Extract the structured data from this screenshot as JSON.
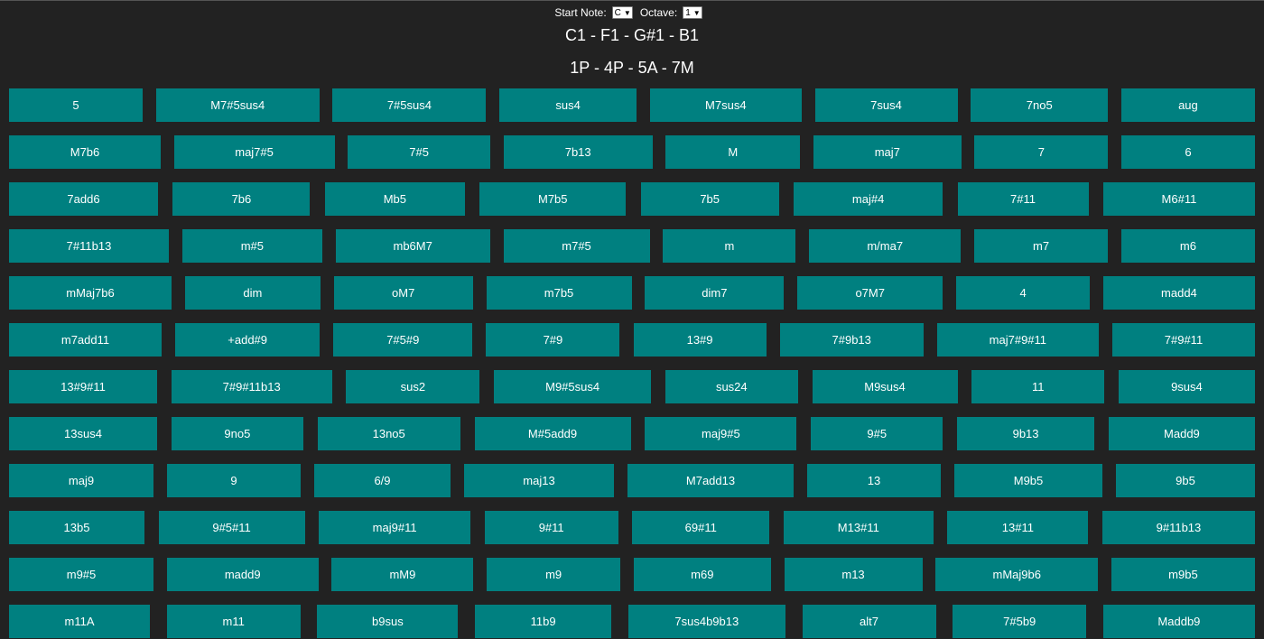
{
  "controls": {
    "start_note_label": "Start Note:",
    "start_note_value": "C",
    "octave_label": "Octave:",
    "octave_value": "1"
  },
  "notes_display": "C1 - F1 - G#1 - B1",
  "intervals_display": "1P - 4P - 5A - 7M",
  "chord_rows": [
    [
      "5",
      "M7#5sus4",
      "7#5sus4",
      "sus4",
      "M7sus4",
      "7sus4",
      "7no5",
      "aug"
    ],
    [
      "M7b6",
      "maj7#5",
      "7#5",
      "7b13",
      "M",
      "maj7",
      "7",
      "6"
    ],
    [
      "7add6",
      "7b6",
      "Mb5",
      "M7b5",
      "7b5",
      "maj#4",
      "7#11",
      "M6#11"
    ],
    [
      "7#11b13",
      "m#5",
      "mb6M7",
      "m7#5",
      "m",
      "m/ma7",
      "m7",
      "m6"
    ],
    [
      "mMaj7b6",
      "dim",
      "oM7",
      "m7b5",
      "dim7",
      "o7M7",
      "4",
      "madd4"
    ],
    [
      "m7add11",
      "+add#9",
      "7#5#9",
      "7#9",
      "13#9",
      "7#9b13",
      "maj7#9#11",
      "7#9#11"
    ],
    [
      "13#9#11",
      "7#9#11b13",
      "sus2",
      "M9#5sus4",
      "sus24",
      "M9sus4",
      "11",
      "9sus4"
    ],
    [
      "13sus4",
      "9no5",
      "13no5",
      "M#5add9",
      "maj9#5",
      "9#5",
      "9b13",
      "Madd9"
    ],
    [
      "maj9",
      "9",
      "6/9",
      "maj13",
      "M7add13",
      "13",
      "M9b5",
      "9b5"
    ],
    [
      "13b5",
      "9#5#11",
      "maj9#11",
      "9#11",
      "69#11",
      "M13#11",
      "13#11",
      "9#11b13"
    ],
    [
      "m9#5",
      "madd9",
      "mM9",
      "m9",
      "m69",
      "m13",
      "mMaj9b6",
      "m9b5"
    ],
    [
      "m11A",
      "m11",
      "b9sus",
      "11b9",
      "7sus4b9b13",
      "alt7",
      "7#5b9",
      "Maddb9"
    ]
  ]
}
